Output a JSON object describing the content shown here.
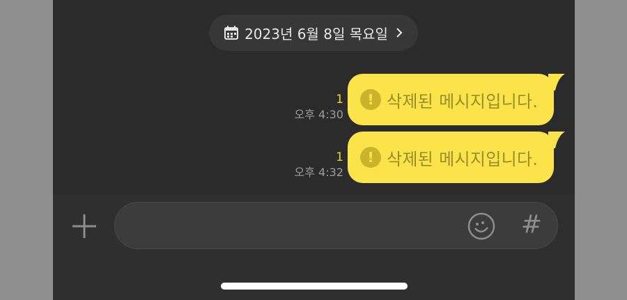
{
  "date_header": {
    "label": "2023년 6월 8일 목요일",
    "icon": "calendar-icon",
    "chevron": "chevron-right-icon"
  },
  "messages": [
    {
      "unread": "1",
      "time": "오후 4:30",
      "text": "삭제된 메시지입니다.",
      "icon": "exclamation-icon"
    },
    {
      "unread": "1",
      "time": "오후 4:32",
      "text": "삭제된 메시지입니다.",
      "icon": "exclamation-icon"
    }
  ],
  "composer": {
    "input_value": "",
    "plus_icon": "plus-icon",
    "emoji_icon": "emoji-icon",
    "hash_label": "#"
  },
  "colors": {
    "background": "#2b2b2b",
    "bubble": "#fbe44a",
    "bubble_text": "#9a8c2b",
    "unread": "#e6d23a",
    "time": "#9d9d9d",
    "side_gutter": "#8f8f8f"
  }
}
